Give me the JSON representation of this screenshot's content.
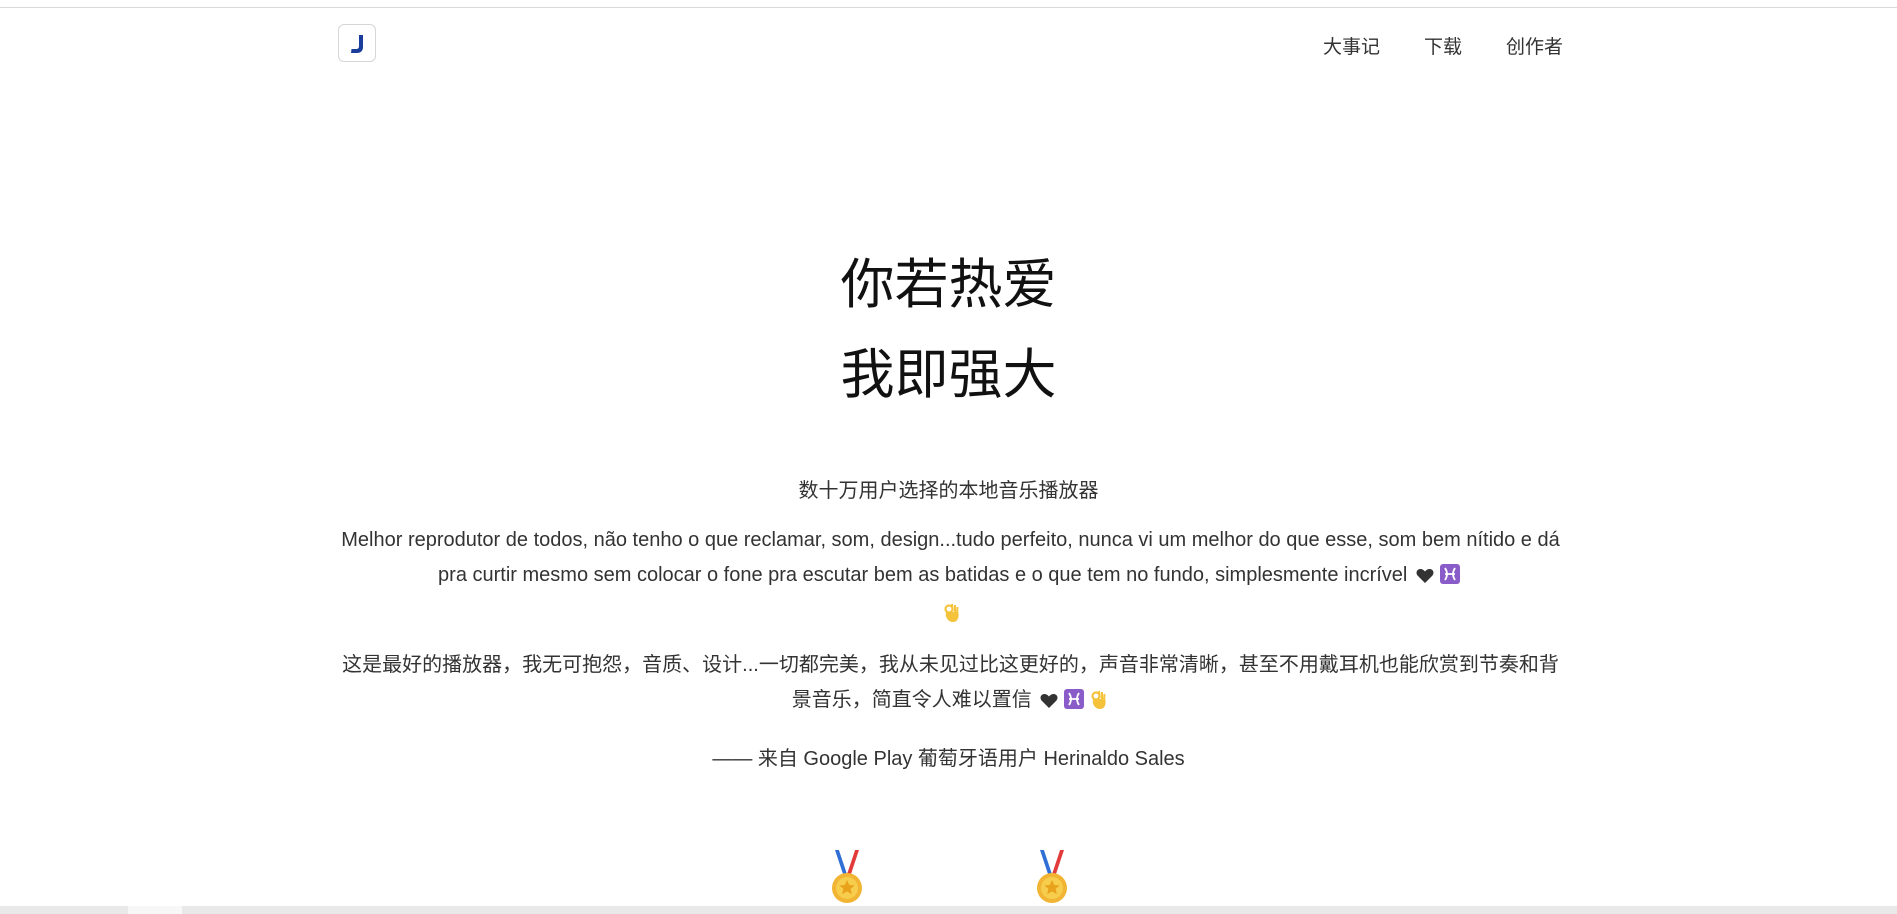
{
  "header": {
    "logo_letter": "J",
    "nav": [
      "大事记",
      "下载",
      "创作者"
    ]
  },
  "hero": {
    "line1": "你若热爱",
    "line2": "我即强大",
    "subtitle": "数十万用户选择的本地音乐播放器"
  },
  "review": {
    "portuguese": "Melhor reprodutor de todos, não tenho o que reclamar, som, design...tudo perfeito, nunca vi um melhor do que esse, som bem nítido e dá pra curtir mesmo sem colocar o fone pra escutar bem as batidas e o que tem no fundo, simplesmente incrível",
    "chinese": "这是最好的播放器，我无可抱怨，音质、设计...一切都完美，我从未见过比这更好的，声音非常清晰，甚至不用戴耳机也能欣赏到节奏和背景音乐，简直令人难以置信",
    "emojis": [
      "black-heart-icon",
      "pisces-icon",
      "ok-hand-icon"
    ],
    "attribution": "—— 来自 Google Play 葡萄牙语用户 Herinaldo Sales"
  },
  "awards": {
    "icons": [
      "medal-icon",
      "medal-icon"
    ]
  },
  "colors": {
    "logo_blue": "#1a3d9c",
    "text": "#333333",
    "title": "#111111",
    "pisces_purple": "#8a5cc9",
    "ok_hand_yellow": "#f5c33b"
  }
}
